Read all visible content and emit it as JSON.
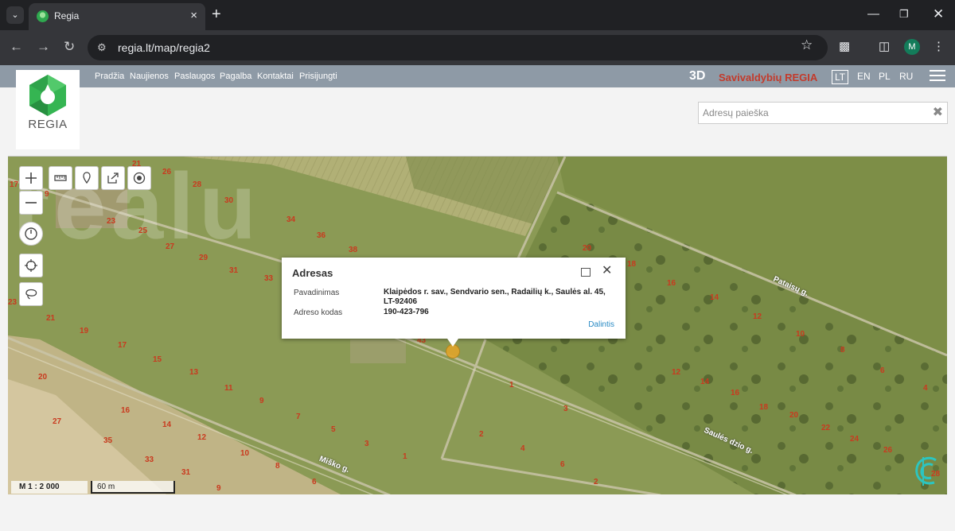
{
  "browser": {
    "tab_title": "Regia",
    "url": "regia.lt/map/regia2",
    "profile_initial": "M"
  },
  "site": {
    "nav": [
      "Pradžia",
      "Naujienos",
      "Paslaugos",
      "Pagalba",
      "Kontaktai",
      "Prisijungti"
    ],
    "brand_3d": "3D",
    "brand_name": "Savivaldybių REGIA",
    "languages": [
      "LT",
      "EN",
      "PL",
      "RU"
    ],
    "active_language": "LT",
    "logo_text": "REGIA",
    "search_placeholder": "Adresų paieška"
  },
  "map": {
    "popup": {
      "title": "Adresas",
      "name_label": "Pavadinimas",
      "name_value": "Klaipėdos r. sav., Sendvario sen., Radailių k., Saulės al. 45, LT-92406",
      "code_label": "Adreso kodas",
      "code_value": "190-423-796",
      "share_label": "Dalintis"
    },
    "scale_ratio": "M 1 : 2 000",
    "scale_length": "60 m",
    "streets": [
      "Pataisų g.",
      "Saulės dzio g.",
      "Miško g."
    ],
    "lot_numbers": [
      "17",
      "9",
      "21",
      "26",
      "28",
      "30",
      "23",
      "25",
      "34",
      "36",
      "38",
      "27",
      "29",
      "31",
      "33",
      "23",
      "21",
      "19",
      "17",
      "15",
      "20",
      "13",
      "11",
      "9",
      "7",
      "5",
      "3",
      "1",
      "16",
      "14",
      "12",
      "10",
      "8",
      "6",
      "27",
      "35",
      "33",
      "31",
      "9",
      "20",
      "18",
      "16",
      "14",
      "12",
      "10",
      "8",
      "6",
      "4",
      "12",
      "14",
      "16",
      "18",
      "20",
      "22",
      "24",
      "26",
      "28",
      "1",
      "2",
      "3",
      "4",
      "6",
      "43",
      "2"
    ],
    "corner_logo": "regia-corner-icon"
  },
  "watermark": "realu"
}
